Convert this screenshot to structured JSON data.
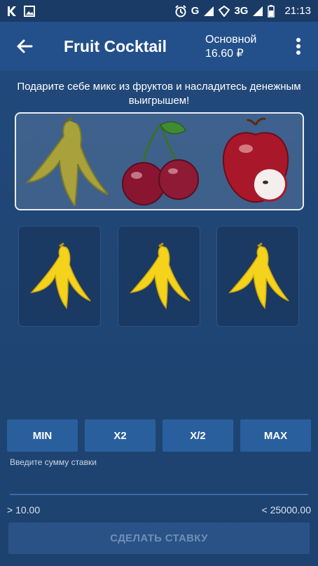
{
  "status_bar": {
    "network": "3G",
    "carrier_letter": "G",
    "time": "21:13"
  },
  "header": {
    "title": "Fruit Cocktail",
    "account_name": "Основной",
    "balance": "16.60 ₽"
  },
  "subtitle": "Подарите себе микс из фруктов и насладитесь денежным выигрышем!",
  "fruits": [
    "banana-peel",
    "cherries",
    "apple"
  ],
  "slots": [
    "banana-peel",
    "banana-peel",
    "banana-peel"
  ],
  "bet_buttons": {
    "min": "MIN",
    "x2": "X2",
    "half": "X/2",
    "max": "MAX"
  },
  "amount": {
    "label": "Введите сумму ставки",
    "value": "",
    "min_limit": "> 10.00",
    "max_limit": "< 25000.00"
  },
  "submit_label": "СДЕЛАТЬ СТАВКУ",
  "colors": {
    "app_bar": "#23508a",
    "background": "#1f4675",
    "button": "#2a5f9e",
    "banana": "#f5d21c"
  }
}
